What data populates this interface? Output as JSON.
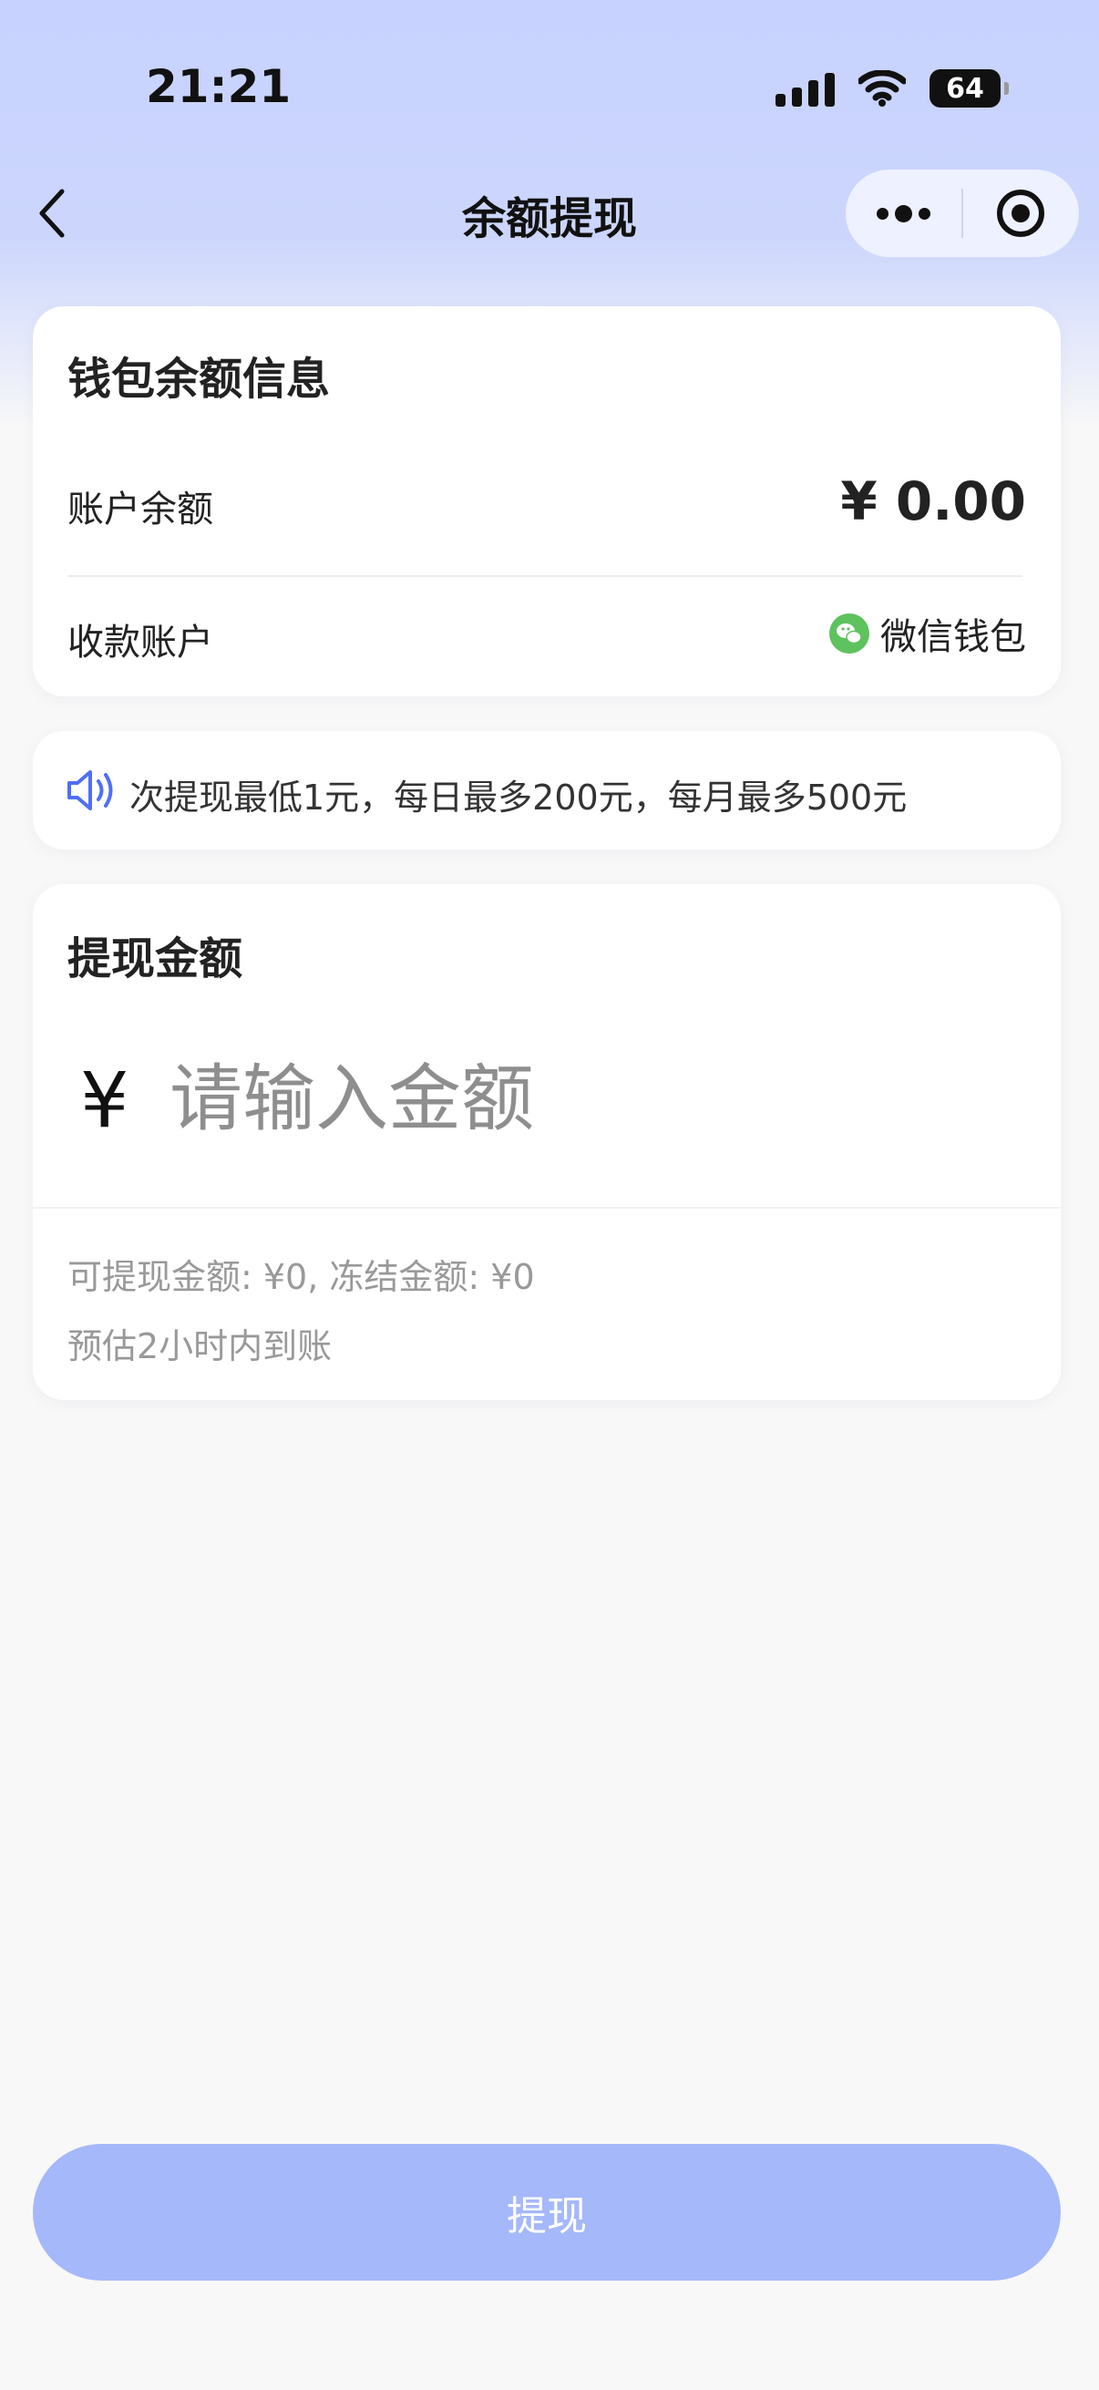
{
  "status_bar": {
    "time": "21:21",
    "battery": "64"
  },
  "nav": {
    "title": "余额提现"
  },
  "wallet_card": {
    "title": "钱包余额信息",
    "balance_label": "账户余额",
    "balance_value": "¥ 0.00",
    "account_label": "收款账户",
    "account_value": "微信钱包"
  },
  "notice": {
    "text": "次提现最低1元，每日最多200元，每月最多500元"
  },
  "amount_card": {
    "title": "提现金额",
    "currency": "¥",
    "placeholder": "请输入金额",
    "available_text": "可提现金额: ¥0, 冻结金额: ¥0",
    "eta_text": "预估2小时内到账"
  },
  "submit_button": {
    "label": "提现"
  },
  "colors": {
    "accent": "#a5b8fa",
    "header_bg": "#c7d2fe",
    "notice_icon": "#4f6ef7",
    "wechat_green": "#5ec25e"
  },
  "icons": [
    "back-arrow-icon",
    "more-dots-icon",
    "target-circle-icon",
    "speaker-icon",
    "wechat-icon",
    "wifi-icon",
    "signal-icon",
    "battery-icon"
  ]
}
